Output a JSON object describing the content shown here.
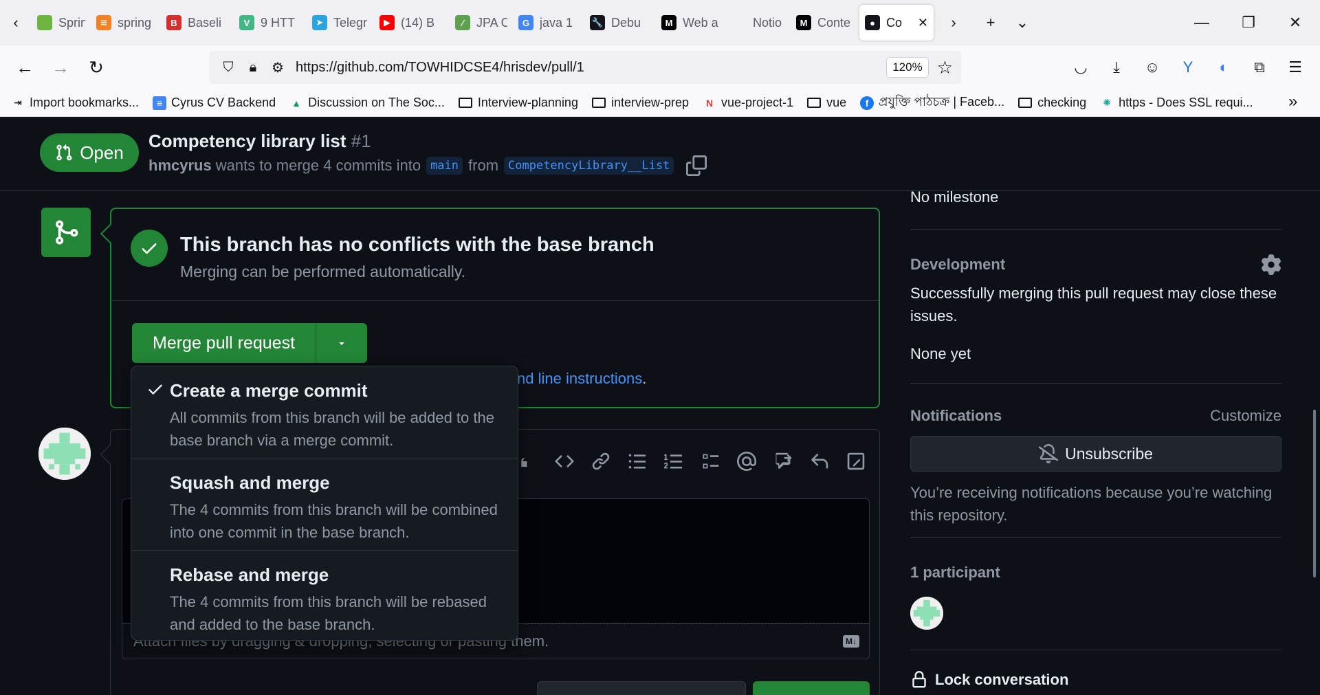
{
  "browser": {
    "tabs": [
      {
        "label": "Spring",
        "icon": "spring-leaf-icon",
        "icon_color": "#6db33f",
        "icon_char": ""
      },
      {
        "label": "spring",
        "icon": "stackoverflow-icon",
        "icon_color": "#f48024",
        "icon_char": "≋"
      },
      {
        "label": "Baseli",
        "icon": "baeldung-icon",
        "icon_color": "#d32f2f",
        "icon_char": "B"
      },
      {
        "label": "9 HTT",
        "icon": "vuejs-icon",
        "icon_color": "#41b883",
        "icon_char": "V"
      },
      {
        "label": "Telegr",
        "icon": "telegram-icon",
        "icon_color": "#2aa3df",
        "icon_char": "➤"
      },
      {
        "label": "(14) B",
        "icon": "youtube-icon",
        "icon_color": "#ff0000",
        "icon_char": "▶"
      },
      {
        "label": "JPA C",
        "icon": "jpa-icon",
        "icon_color": "#5fa04e",
        "icon_char": "⁄"
      },
      {
        "label": "java 1",
        "icon": "google-icon",
        "icon_color": "#4285f4",
        "icon_char": "G"
      },
      {
        "label": "Debu",
        "icon": "wrench-icon",
        "icon_color": "#15141a",
        "icon_char": "🔧"
      },
      {
        "label": "Web a",
        "icon": "medium-icon",
        "icon_color": "#000000",
        "icon_char": "M"
      },
      {
        "label": "Notio",
        "icon": "notion-icon",
        "icon_color": "#f0f0f4",
        "icon_char": ""
      },
      {
        "label": "Conte",
        "icon": "medium-icon",
        "icon_color": "#000000",
        "icon_char": "M"
      },
      {
        "label": "Co",
        "icon": "github-icon",
        "icon_color": "#15141a",
        "icon_char": "●"
      }
    ],
    "url": "https://github.com/TOWHIDCSE4/hrisdev/pull/1",
    "zoom": "120%",
    "bookmarks": [
      {
        "label": "Import bookmarks...",
        "kind": "import"
      },
      {
        "label": "Cyrus CV Backend",
        "kind": "docs"
      },
      {
        "label": "Discussion on The Soc...",
        "kind": "drive"
      },
      {
        "label": "Interview-planning",
        "kind": "folder"
      },
      {
        "label": "interview-prep",
        "kind": "folder"
      },
      {
        "label": "vue-project-1",
        "kind": "n"
      },
      {
        "label": "vue",
        "kind": "folder"
      },
      {
        "label": "প্রযুক্তি পাঠচক্র | Faceb...",
        "kind": "facebook"
      },
      {
        "label": "checking",
        "kind": "folder"
      },
      {
        "label": "https - Does SSL requi...",
        "kind": "ssl"
      }
    ]
  },
  "pr": {
    "state": "Open",
    "title": "Competency library list",
    "number": "#1",
    "author": "hmcyrus",
    "meta_text": "wants to merge 4 commits into",
    "base_branch": "main",
    "from_text": "from",
    "head_branch": "CompetencyLibrary__List"
  },
  "merge": {
    "title": "This branch has no conflicts with the base branch",
    "subtitle": "Merging can be performed automatically.",
    "button_label": "Merge pull request",
    "cmdline_prefix": "",
    "cmdline_link": "nd line instructions",
    "cmdline_suffix": "."
  },
  "dropdown": {
    "items": [
      {
        "title": "Create a merge commit",
        "desc": "All commits from this branch will be added to the base branch via a merge commit.",
        "checked": true
      },
      {
        "title": "Squash and merge",
        "desc": "The 4 commits from this branch will be combined into one commit in the base branch.",
        "checked": false
      },
      {
        "title": "Rebase and merge",
        "desc": "The 4 commits from this branch will be rebased and added to the base branch.",
        "checked": false
      }
    ]
  },
  "comment": {
    "attach_text": "Attach files by dragging & dropping, selecting or pasting them."
  },
  "sidebar": {
    "milestone": "No milestone",
    "development_heading": "Development",
    "development_text": "Successfully merging this pull request may close these issues.",
    "development_none": "None yet",
    "notifications_heading": "Notifications",
    "customize_label": "Customize",
    "unsubscribe_label": "Unsubscribe",
    "notifications_text": "You’re receiving notifications because you’re watching this repository.",
    "participants_heading": "1 participant",
    "lock_label": "Lock conversation"
  },
  "colors": {
    "success": "#238636",
    "link": "#4493f8",
    "background": "#0d1117"
  }
}
